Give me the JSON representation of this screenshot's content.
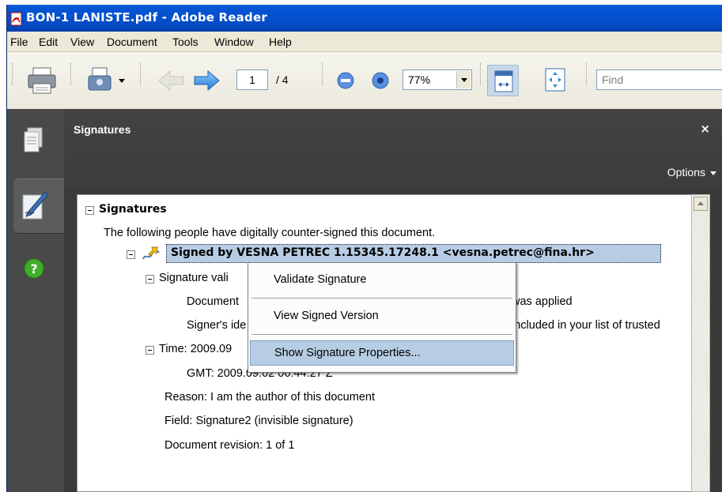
{
  "window": {
    "title": "BON-1 LANISTE.pdf - Adobe Reader"
  },
  "menu": [
    "File",
    "Edit",
    "View",
    "Document",
    "Tools",
    "Window",
    "Help"
  ],
  "toolbar": {
    "page_current": "1",
    "page_total": "/ 4",
    "zoom": "77%",
    "find_placeholder": "Find"
  },
  "panel": {
    "title": "Signatures",
    "close": "×",
    "options": "Options"
  },
  "tree": {
    "root": "Signatures",
    "intro": "The following people have digitally counter-signed this document.",
    "signer": "Signed by VESNA PETREC 1.15345.17248.1 <vesna.petrec@fina.hr>",
    "validity_label": "Signature vali",
    "doc_line": "Document",
    "doc_line_end": "was applied",
    "signer_id": "Signer's ide",
    "signer_id_end": "included in your list of trusted",
    "time_label": "Time: 2009.09",
    "gmt": "GMT: 2009.09.02 06:44:27 Z",
    "reason": "Reason: I am the author of this document",
    "field": "Field: Signature2 (invisible signature)",
    "revision": "Document revision: 1 of 1"
  },
  "context_menu": {
    "items": [
      "Validate Signature",
      "View Signed Version",
      "Show Signature Properties..."
    ],
    "highlighted": "Show Signature Properties..."
  },
  "colors": {
    "titlebar": "#0450cc",
    "panel": "#3a3a3a",
    "selection": "#b6cde4"
  }
}
